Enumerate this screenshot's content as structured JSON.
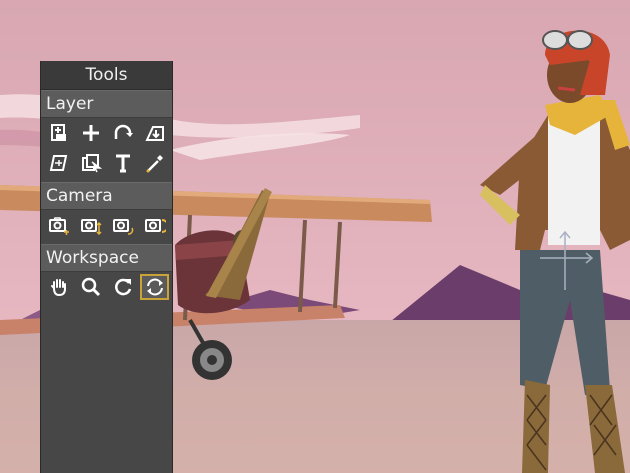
{
  "panel": {
    "title": "Tools",
    "sections": [
      {
        "label": "Layer",
        "tools": [
          "layer-add-icon",
          "move-plus-icon",
          "rotate-arc-icon",
          "layer-down-icon",
          "transform-icon",
          "layer-select-icon",
          "text-icon",
          "eyedropper-icon"
        ]
      },
      {
        "label": "Camera",
        "tools": [
          "camera-move-icon",
          "camera-zoom-icon",
          "camera-rotate-icon",
          "camera-pan-icon"
        ]
      },
      {
        "label": "Workspace",
        "tools": [
          "hand-icon",
          "zoom-icon",
          "refresh-icon",
          "orbit-icon"
        ]
      }
    ],
    "selected_tool": "orbit-icon"
  },
  "colors": {
    "panel_bg": "#474747",
    "header_bg": "#5c5c5c",
    "icon": "#ffffff",
    "selection": "#c9a23a"
  }
}
